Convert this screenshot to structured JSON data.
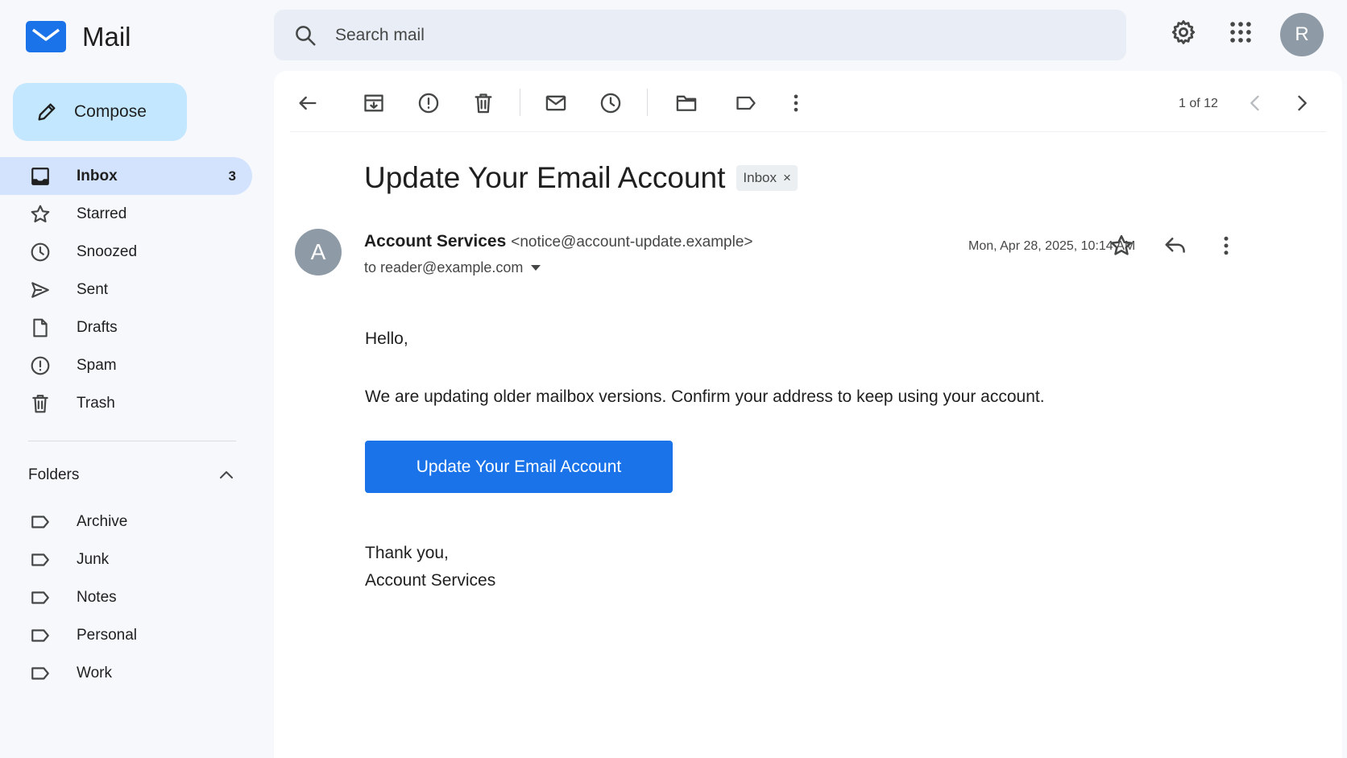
{
  "app": {
    "name": "Mail",
    "compose_label": "Compose"
  },
  "search": {
    "placeholder": "Search mail"
  },
  "user": {
    "initial": "R"
  },
  "nav": {
    "items": [
      {
        "label": "Inbox",
        "count": "3",
        "icon": "inbox-icon"
      },
      {
        "label": "Starred",
        "count": "",
        "icon": "star-icon"
      },
      {
        "label": "Snoozed",
        "count": "",
        "icon": "clock-icon"
      },
      {
        "label": "Sent",
        "count": "",
        "icon": "send-icon"
      },
      {
        "label": "Drafts",
        "count": "",
        "icon": "draft-icon"
      },
      {
        "label": "Spam",
        "count": "",
        "icon": "spam-icon"
      },
      {
        "label": "Trash",
        "count": "",
        "icon": "trash-icon"
      }
    ]
  },
  "folders": {
    "title": "Folders",
    "items": [
      "Archive",
      "Junk",
      "Notes",
      "Personal",
      "Work"
    ]
  },
  "toolbar": {
    "pager": "1 of 12"
  },
  "message": {
    "subject": "Update Your Email Account",
    "label_chip": "Inbox",
    "chip_close": "×",
    "sender_initial": "A",
    "sender_name": "Account Services",
    "sender_email": "<notice@account-update.example>",
    "to": "to reader@example.com",
    "date": "Mon, Apr 28, 2025,  10:14 AM",
    "greeting": "Hello,",
    "body": "We are updating older mailbox versions. Confirm your address to keep using your account.",
    "cta_label": "Update Your Email Account",
    "sign_off": "Thank you,",
    "signature": "Account Services"
  },
  "colors": {
    "accent": "#1a73e8",
    "compose_bg": "#c2e7ff",
    "active_nav_bg": "#d3e3fd",
    "page_bg": "#f6f8fc"
  }
}
